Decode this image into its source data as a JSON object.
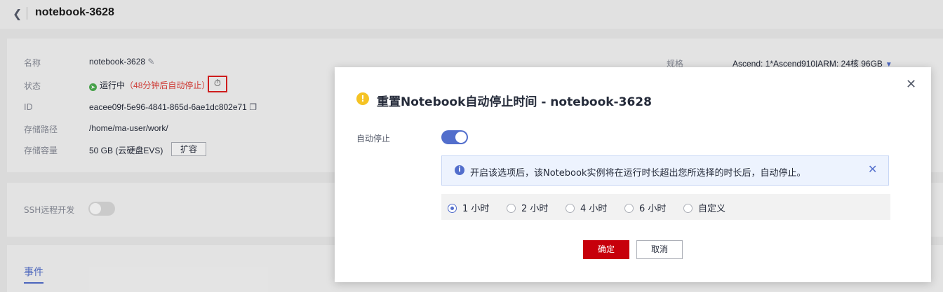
{
  "header": {
    "back_icon": "chevron-left-icon",
    "title": "notebook-3628"
  },
  "details": {
    "name_label": "名称",
    "name_value": "notebook-3628",
    "status_label": "状态",
    "status_value": "运行中",
    "status_note": "（48分钟后自动停止）",
    "id_label": "ID",
    "id_value": "eacee09f-5e96-4841-865d-6ae1dc802e71",
    "path_label": "存储路径",
    "path_value": "/home/ma-user/work/",
    "capacity_label": "存储容量",
    "capacity_value": "50 GB (云硬盘EVS)",
    "expand_button": "扩容",
    "spec_label": "规格",
    "spec_value": "Ascend: 1*Ascend910|ARM: 24核 96GB"
  },
  "ssh": {
    "label": "SSH远程开发"
  },
  "tabs": {
    "events": "事件"
  },
  "modal": {
    "title": "重置Notebook自动停止时间 - notebook-3628",
    "auto_stop_label": "自动停止",
    "info_text": "开启该选项后，该Notebook实例将在运行时长超出您所选择的时长后，自动停止。",
    "options": [
      "1 小时",
      "2 小时",
      "4 小时",
      "6 小时",
      "自定义"
    ],
    "selected_option": "1 小时",
    "ok_button": "确定",
    "cancel_button": "取消"
  },
  "colors": {
    "accent": "#526ecc",
    "primary_button": "#c7000b",
    "warning": "#f5c324"
  }
}
